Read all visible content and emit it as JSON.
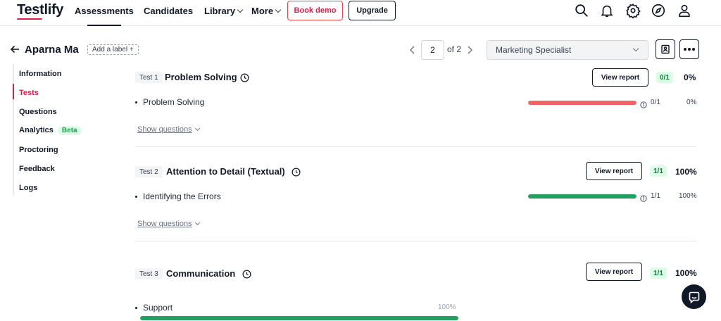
{
  "nav": {
    "logo": "Testlify",
    "links": [
      "Assessments",
      "Candidates",
      "Library",
      "More"
    ],
    "book_demo": "Book demo",
    "upgrade": "Upgrade"
  },
  "header": {
    "candidate_name": "Aparna Ma",
    "add_label": "Add a label +",
    "page_current": "2",
    "page_of": "of 2",
    "role": "Marketing Specialist"
  },
  "sidebar": {
    "items": [
      "Information",
      "Tests",
      "Questions",
      "Analytics",
      "Proctoring",
      "Feedback",
      "Logs"
    ],
    "active": "Tests",
    "beta": "Beta"
  },
  "tests": [
    {
      "tag": "Test 1",
      "title": "Problem Solving",
      "view_report": "View report",
      "score": "0/1",
      "percent": "0%",
      "skill": "Problem Solving",
      "skill_score": "0/1",
      "skill_percent": "0%",
      "skill_fill": 1.0,
      "bar_color": "#f26464",
      "show_questions": "Show questions"
    },
    {
      "tag": "Test 2",
      "title": "Attention to Detail (Textual)",
      "view_report": "View report",
      "score": "1/1",
      "percent": "100%",
      "skill": "Identifying the Errors",
      "skill_score": "1/1",
      "skill_percent": "100%",
      "skill_fill": 1.0,
      "bar_color": "#22a060",
      "show_questions": "Show questions"
    },
    {
      "tag": "Test 3",
      "title": "Communication",
      "view_report": "View report",
      "score": "1/1",
      "percent": "100%",
      "skill": "Support",
      "skill_percent": "100%",
      "skill_fill": 1.0,
      "bar_color": "#22a060"
    }
  ],
  "colors": {
    "accent": "#e11d48",
    "success": "#22a060",
    "danger": "#f26464"
  }
}
